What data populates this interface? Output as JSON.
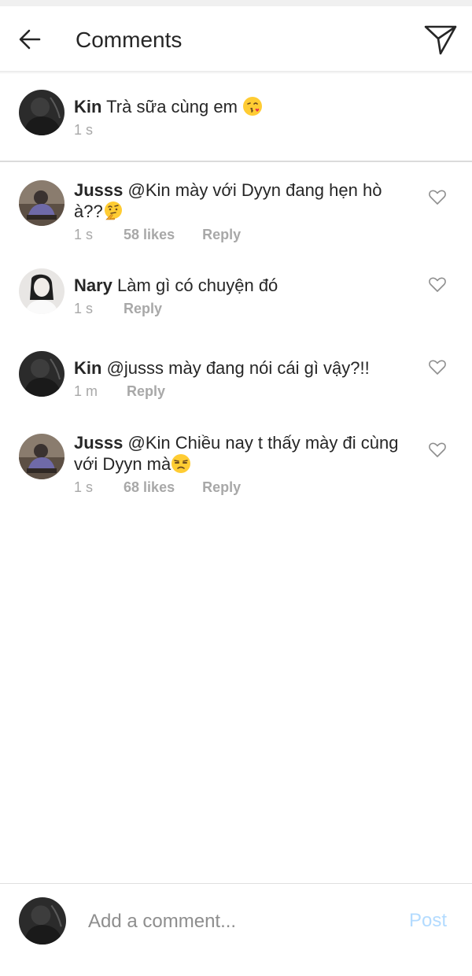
{
  "header": {
    "title": "Comments"
  },
  "caption": {
    "username": "Kin",
    "text": "Trà sữa cùng em",
    "emoji": "kissing-face-heart-emoji",
    "time": "1 s"
  },
  "comments": [
    {
      "username": "Jusss",
      "text": "@Kin mày với Dyyn đang hẹn hò à??",
      "emoji": "thinking-face-emoji",
      "time": "1 s",
      "likes": "58 likes",
      "reply": "Reply"
    },
    {
      "username": "Nary",
      "text": "Làm gì có chuyện đó",
      "time": "1 s",
      "reply": "Reply"
    },
    {
      "username": "Kin",
      "text": "@jusss mày đang nói cái gì vậy?!!",
      "time": "1 m",
      "reply": "Reply"
    },
    {
      "username": "Jusss",
      "text": "@Kin Chiều nay t thấy mày đi cùng với Dyyn mà",
      "emoji": "unamused-face-emoji",
      "time": "1 s",
      "likes": "68 likes",
      "reply": "Reply"
    }
  ],
  "composer": {
    "placeholder": "Add a comment...",
    "post_label": "Post"
  },
  "colors": {
    "text": "#262626",
    "meta": "#a8a8a8",
    "post_disabled": "#b3dbff",
    "divider": "#dbdbdb"
  }
}
